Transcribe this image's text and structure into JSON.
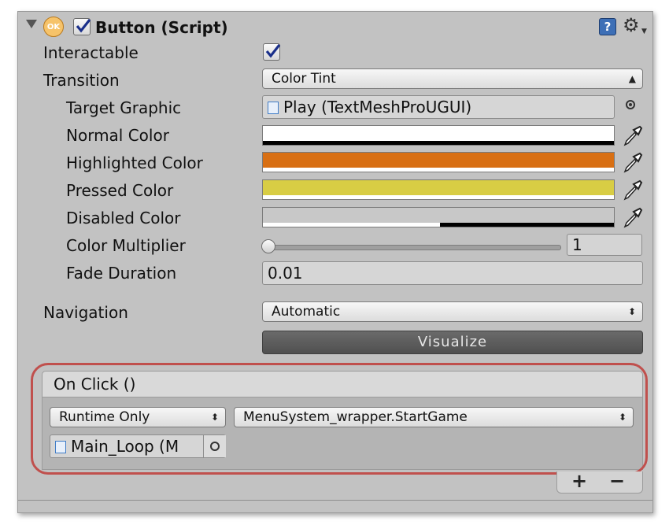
{
  "component": {
    "badge": "OK",
    "title": "Button (Script)",
    "enabled": true
  },
  "props": {
    "interactable_label": "Interactable",
    "interactable_checked": true,
    "transition_label": "Transition",
    "transition_value": "Color Tint",
    "target_graphic_label": "Target Graphic",
    "target_graphic_value": "Play (TextMeshProUGUI)",
    "normal_color_label": "Normal Color",
    "highlighted_color_label": "Highlighted Color",
    "pressed_color_label": "Pressed Color",
    "disabled_color_label": "Disabled Color",
    "color_multiplier_label": "Color Multiplier",
    "color_multiplier_value": "1",
    "fade_duration_label": "Fade Duration",
    "fade_duration_value": "0.01",
    "navigation_label": "Navigation",
    "navigation_value": "Automatic",
    "visualize_label": "Visualize"
  },
  "colors": {
    "normal": "#ffffff",
    "highlighted": "#d86f13",
    "pressed": "#d8cd44",
    "disabled": "#c8c8c8",
    "highlight_ring": "#c0504d"
  },
  "onclick": {
    "header": "On Click ()",
    "runtime_value": "Runtime Only",
    "function_value": "MenuSystem_wrapper.StartGame",
    "object_value": "Main_Loop (M",
    "add_label": "+",
    "remove_label": "−"
  },
  "icons": {
    "help": "help-book-icon",
    "settings": "gear-icon",
    "picker": "eyedropper-icon"
  }
}
